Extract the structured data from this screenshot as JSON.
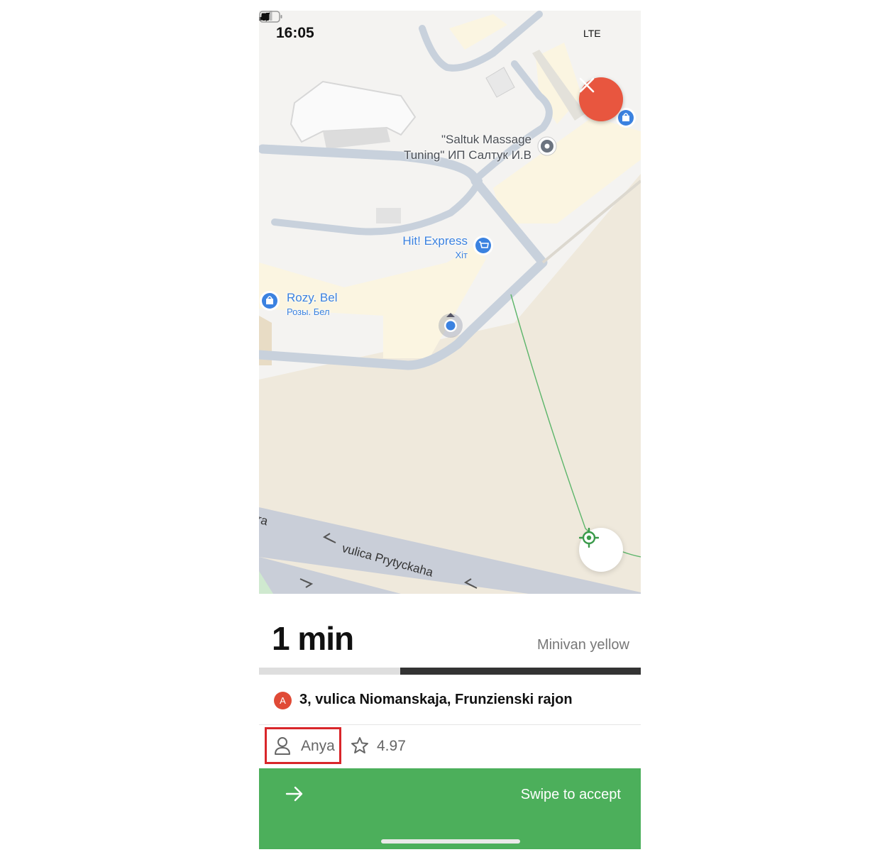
{
  "status_bar": {
    "time": "16:05",
    "network": "LTE"
  },
  "map": {
    "pois": [
      {
        "name": "\"Saltuk Massage",
        "name2": "Tuning\" ИП Салтук И.В",
        "icon": "pin-icon"
      },
      {
        "name": "Hit! Express",
        "subtitle": "Хіт",
        "icon": "shopping-cart-icon"
      },
      {
        "name": "Rozy. Bel",
        "subtitle": "Розы. Бел",
        "icon": "shopping-bag-icon"
      }
    ],
    "streets": [
      "vulica Prytyckaha",
      "ra"
    ],
    "colors": {
      "poi_blue": "#3b82e0",
      "road": "#c8d1dc",
      "route_line": "#5cb56a"
    }
  },
  "controls": {
    "close_icon": "close-icon",
    "locate_icon": "locate-crosshair-icon"
  },
  "ride": {
    "eta": "1 min",
    "vehicle": "Minivan yellow",
    "progress": 0.37,
    "pickup_badge": "A",
    "pickup_address": "3, vulica Niomanskaja, Frunzienski rajon",
    "rider_name": "Anya",
    "rating": "4.97"
  },
  "action": {
    "swipe_label": "Swipe to accept",
    "color": "#4caf5b"
  }
}
